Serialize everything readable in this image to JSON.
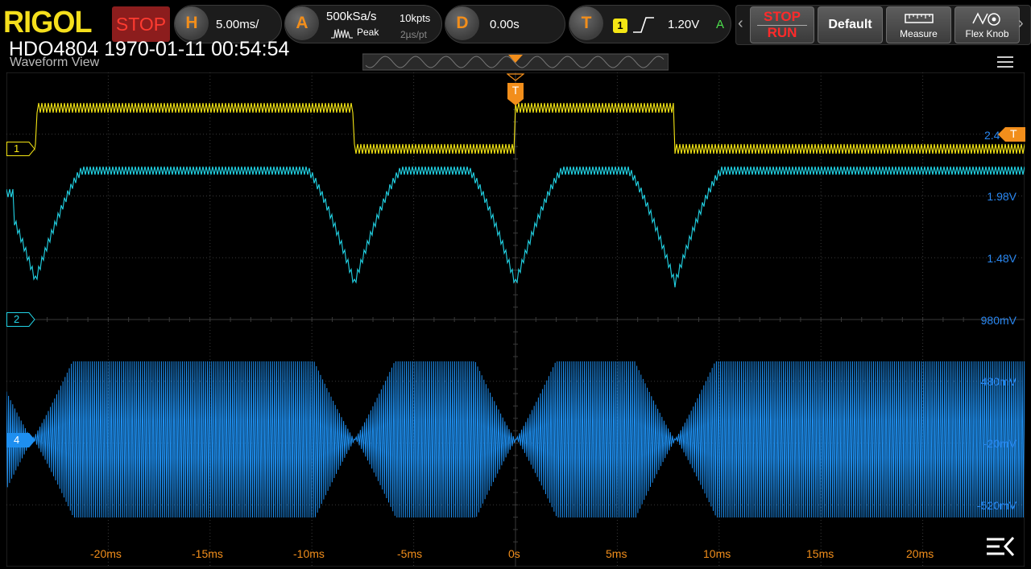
{
  "header": {
    "logo": "RIGOL",
    "run_state": "STOP",
    "horizontal": {
      "key": "H",
      "scale": "5.00ms/"
    },
    "acquire": {
      "key": "A",
      "sample_rate": "500kSa/s",
      "mode": "Peak",
      "memory": "10kpts",
      "resolution": "2µs/pt"
    },
    "delay": {
      "key": "D",
      "offset": "0.00s"
    },
    "trigger": {
      "key": "T",
      "source": "1",
      "level": "1.20V",
      "mode": "A"
    },
    "buttons": {
      "stop_label": "STOP",
      "run_label": "RUN",
      "default_label": "Default",
      "measure_label": "Measure",
      "flexknob_label": "Flex Knob"
    }
  },
  "info": {
    "model_time": "HDO4804 1970-01-11 00:54:54",
    "view_title": "Waveform View"
  },
  "markers": {
    "trigger_marker": "T",
    "ch1": "1",
    "ch2": "2",
    "ch4": "4",
    "trig_level_value": "2.4"
  },
  "right_labels": [
    "1.98V",
    "1.48V",
    "980mV",
    "480mV",
    "-20mV",
    "-520mV"
  ],
  "time_labels": [
    "-20ms",
    "-15ms",
    "-10ms",
    "-5ms",
    "0s",
    "5ms",
    "10ms",
    "15ms",
    "20ms"
  ],
  "colors": {
    "ch1": "#f5e614",
    "ch2": "#22d4e6",
    "ch4": "#1e8ff0",
    "accent": "#f28e1b",
    "grid": "#3a3a3a"
  },
  "icons": {
    "menu": "menu-icon",
    "fold": "fold-menu-icon",
    "left": "chevron-left-icon",
    "right": "chevron-right-icon"
  }
}
